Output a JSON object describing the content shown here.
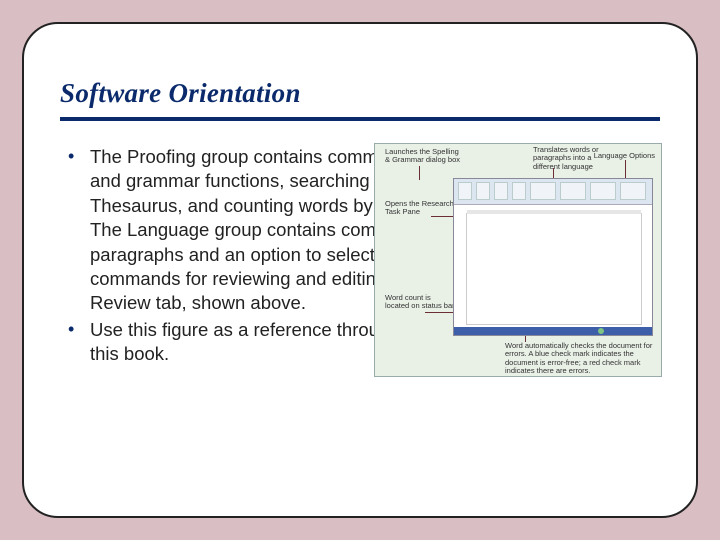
{
  "title": "Software Orientation",
  "bullets": [
    "The Proofing group contains commands for launching Word's spelling and grammar functions, searching through references, using the Thesaurus, and counting words by characters, paragraphs, and lines. The Language group contains com­mands for translating words or paragraphs and an option to select a language. These and other commands for reviewing and editing documents are located on the Review tab, shown above.",
    "Use this figure as a reference throughout this lesson and the rest of this book."
  ],
  "figure": {
    "callout_top_left": "Launches the Spelling & Grammar dialog box",
    "callout_top_center": "Translates words or paragraphs into a different language",
    "callout_top_right": "Language Options",
    "callout_mid_left": "Opens the Research Task Pane",
    "callout_mid_left_wordcount": "Word count is located on status bar",
    "callout_bottom_right": "Word automatically checks the document for errors. A blue check mark indicates the document is error-free; a red check mark indicates there are errors."
  }
}
